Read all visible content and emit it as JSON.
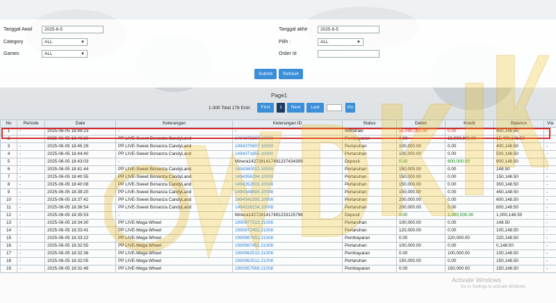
{
  "filter": {
    "tanggal_awal_label": "Tanggal Awal",
    "tanggal_awal_value": "2025-6-5",
    "tanggal_akhir_label": "Tanggal akhir",
    "tanggal_akhir_value": "2025-6-5",
    "category_label": "Category",
    "category_value": "ALL",
    "pilih_label": "Pilih :",
    "pilih_value": "ALL",
    "games_label": "Games",
    "games_value": "ALL",
    "order_id_label": "Order Id",
    "order_id_value": "",
    "submit_label": "Submit",
    "refresh_label": "Refresh"
  },
  "pager": {
    "page_label": "Page1",
    "info": "1-300 Total 176 Entri",
    "first": "First",
    "current": "1",
    "next": "Next",
    "last": "Last",
    "go": "Go"
  },
  "table": {
    "headers": [
      "No",
      "Periode",
      "Date",
      "Keterangan",
      "Keterangan ID",
      "Status",
      "Debet",
      "Kredit",
      "Balance",
      "Via"
    ],
    "rows": [
      [
        "1",
        "-",
        "2025-06-05 18:49:23",
        "-",
        "-",
        "Withdraw",
        "15,090,000.00",
        "0.00",
        "400,148.50",
        "-"
      ],
      [
        "2",
        "-",
        "2025-06-05 18:48:36",
        "PP LIVE-Sweet Bonanza CandyLand",
        "1494375907.10000",
        "Pembayaran",
        "0.00",
        "15,090,000.00",
        "15,490,148.50",
        "-"
      ],
      [
        "3",
        "-",
        "2025-06-05 18:45:29",
        "PP LIVE-Sweet Bonanza CandyLand",
        "1494375907.10000",
        "Pertaruhan",
        "100,000.00",
        "0.00",
        "400,148.50",
        "-"
      ],
      [
        "4",
        "-",
        "2025-06-05 18:44:40",
        "PP LIVE-Sweet Bonanza CandyLand",
        "1494371855.10000",
        "Pertaruhan",
        "100,000.00",
        "0.00",
        "500,148.50",
        "-"
      ],
      [
        "5",
        "-",
        "2025-06-05 18:43:03",
        "-",
        "Minera142728141749123743430​9",
        "Deposit",
        "0.00",
        "600,000.00",
        "600,148.50",
        "-"
      ],
      [
        "6",
        "-",
        "2025-06-05 18:41:44",
        "PP LIVE-Sweet Bonanza CandyLand",
        "1494360012.10000",
        "Pertaruhan",
        "150,000.00",
        "0.00",
        "148.50",
        "-"
      ],
      [
        "7",
        "-",
        "2025-06-05 18:40:55",
        "PP LIVE-Sweet Bonanza CandyLand",
        "1494356294.10000",
        "Pertaruhan",
        "150,000.00",
        "0.00",
        "150,148.50",
        "-"
      ],
      [
        "8",
        "-",
        "2025-06-05 18:40:08",
        "PP LIVE-Sweet Bonanza CandyLand",
        "1494352003.10008",
        "Pertaruhan",
        "150,000.00",
        "0.00",
        "300,148.50",
        "-"
      ],
      [
        "9",
        "-",
        "2025-06-05 18:39:20",
        "PP LIVE-Sweet Bonanza CandyLand",
        "1494348894.10008",
        "Pertaruhan",
        "150,000.00",
        "0.00",
        "450,148.50",
        "-"
      ],
      [
        "10",
        "-",
        "2025-06-05 18:37:42",
        "PP LIVE-Sweet Bonanza CandyLand",
        "1494341395.10008",
        "Pertaruhan",
        "200,000.00",
        "0.00",
        "600,148.50",
        "-"
      ],
      [
        "11",
        "-",
        "2025-06-05 18:36:54",
        "PP LIVE-Sweet Bonanza CandyLand",
        "1494338154.10008",
        "Pertaruhan",
        "200,000.00",
        "0.00",
        "800,148.50",
        "-"
      ],
      [
        "12",
        "-",
        "2025-06-05 18:35:53",
        "-",
        "Minera142728141749123312579​6",
        "Deposit",
        "0.00",
        "1,000,000.00",
        "1,000,148.50",
        "-"
      ],
      [
        "13",
        "-",
        "2025-06-05 18:34:30",
        "PP LIVE-Mega Wheel",
        "1990977313.21008",
        "Pertaruhan",
        "100,000.00",
        "0.00",
        "148.50",
        "-"
      ],
      [
        "14",
        "-",
        "2025-06-05 18:33:41",
        "PP LIVE-Mega Wheel",
        "1990972402.21008",
        "Pertaruhan",
        "120,000.00",
        "0.00",
        "100,148.50",
        "-"
      ],
      [
        "15",
        "-",
        "2025-06-05 18:33:22",
        "PP LIVE-Mega Wheel",
        "1990967451.21008",
        "Pembayaran",
        "0.00",
        "220,000.00",
        "220,148.50",
        "-"
      ],
      [
        "16",
        "-",
        "2025-06-05 18:32:55",
        "PP LIVE-Mega Wheel",
        "1990967451.21008",
        "Pertaruhan",
        "100,000.00",
        "0.00",
        "0,148.50",
        "-"
      ],
      [
        "17",
        "-",
        "2025-06-05 18:32:36",
        "PP LIVE-Mega Wheel",
        "1990962512.21008",
        "Pembayaran",
        "0.00",
        "100,000.00",
        "100,148.50",
        "-"
      ],
      [
        "18",
        "-",
        "2025-06-05 18:32:05",
        "PP LIVE-Mega Wheel",
        "1990962512.21008",
        "Pertaruhan",
        "150,000.00",
        "0.00",
        "150,148.50",
        "-"
      ],
      [
        "19",
        "-",
        "2025-06-05 18:31:46",
        "PP LIVE-Mega Wheel",
        "1990957568.21008",
        "Pembayaran",
        "0.00",
        "150,000.00",
        "150,148.50",
        "-"
      ]
    ]
  },
  "watermark": {
    "text": "WDKIK",
    "activate_line1": "Activate Windows",
    "activate_line2": "Go to Settings to activate Windows."
  },
  "colors": {
    "accent": "#3a8fd8",
    "highlight": "#d42a2a",
    "link": "#2b7fd4",
    "green": "#0a8a12",
    "red": "#e02020"
  }
}
